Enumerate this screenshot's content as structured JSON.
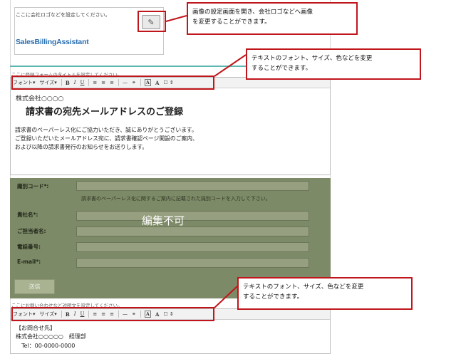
{
  "logo": {
    "hint": "ここに会社ロゴなどを設定してください。",
    "brand": "SalesBillingAssistant",
    "edit_icon": "pencil-icon"
  },
  "top_editor": {
    "label": "ここに登録フォームのタイトルを設定してください。",
    "toolbar": {
      "font": "フォント▾",
      "size": "サイズ▾",
      "bold": "B",
      "italic": "I",
      "underline": "U",
      "align_left": "≡",
      "align_center": "≡",
      "align_right": "≡",
      "hr": "—",
      "link": "⚭",
      "bg_color": "A",
      "text_color": "A",
      "extra": "☐ ⇕"
    },
    "company": "株式会社○○○○",
    "title": "請求書の宛先メールアドレスのご登録",
    "body_lines": [
      "請求書のペーパーレス化にご協力いただき、誠にありがとうございます。",
      "ご登録いただいたメールアドレス宛に、請求書確認ページ開設のご案内、",
      "および以降の請求書発行のお知らせをお送りします。"
    ]
  },
  "form": {
    "code_label": "識別コード*:",
    "code_hint": "請求書のペーパーレス化に関するご案内に記載された識別コードを入力して下さい。",
    "company_label": "貴社名*:",
    "person_label": "ご担当者名:",
    "phone_label": "電話番号:",
    "email_label": "E-mail*:",
    "overlay_text": "編集不可",
    "submit": "送信"
  },
  "bottom_editor": {
    "label": "ここにお問い合わせなど説明文を設定してください。",
    "toolbar": {
      "font": "フォント▾",
      "size": "サイズ▾",
      "bold": "B",
      "italic": "I",
      "underline": "U",
      "align_left": "≡",
      "align_center": "≡",
      "align_right": "≡",
      "hr": "—",
      "link": "⚭",
      "bg_color": "A",
      "text_color": "A",
      "extra": "☐ ⇕"
    },
    "contact_heading": "【お問合せ先】",
    "contact_company": "株式会社○○○○○　経理部",
    "contact_tel": "Tel：00-0000-0000"
  },
  "callouts": {
    "logo": [
      "画像の設定画面を開き、会社ロゴなどへ画像",
      "を変更することができます。"
    ],
    "font_top": [
      "テキストのフォント、サイズ、色などを変更",
      "することができます。"
    ],
    "font_bottom": [
      "テキストのフォント、サイズ、色などを変更",
      "することができます。"
    ]
  },
  "colors": {
    "callout_border": "#c0161b",
    "disabled_overlay": "#7d8a67",
    "accent_line": "#5bb7b0",
    "brand": "#2a6fb0"
  }
}
